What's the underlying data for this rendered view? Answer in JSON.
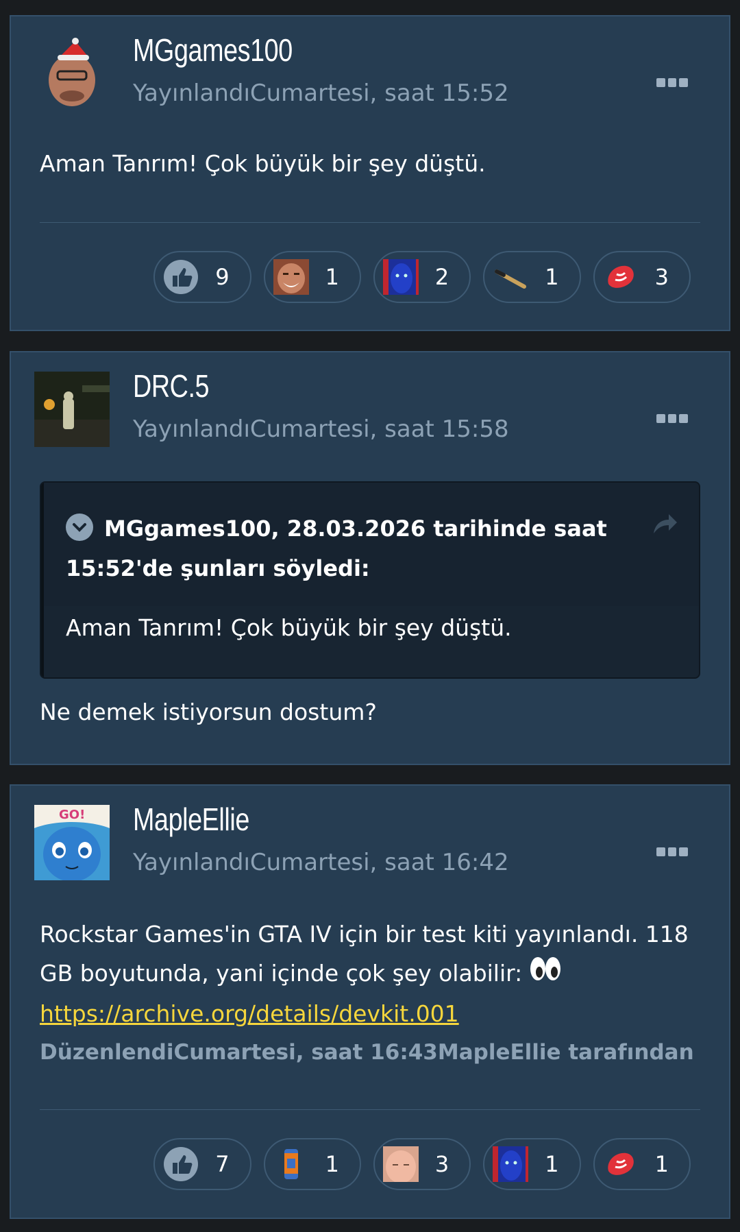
{
  "posts": [
    {
      "username": "MGgames100",
      "posted": "YayınlandıCumartesi, saat 15:52",
      "avatar_icon": "santa-hat-avatar-icon",
      "body": "Aman Tanrım! Çok büyük bir şey düştü.",
      "reactions": [
        {
          "icon": "thumbs-up-icon",
          "count": "9"
        },
        {
          "icon": "laughing-man-icon",
          "count": "1"
        },
        {
          "icon": "blue-face-icon",
          "count": "2"
        },
        {
          "icon": "bat-icon",
          "count": "1"
        },
        {
          "icon": "steak-icon",
          "count": "3"
        }
      ]
    },
    {
      "username": "DRC.5",
      "posted": "YayınlandıCumartesi, saat 15:58",
      "avatar_icon": "game-scene-avatar-icon",
      "quote": {
        "title": "MGgames100, 28.03.2026 tarihinde saat 15:52'de şunları söyledi:",
        "body": "Aman Tanrım! Çok büyük bir şey düştü."
      },
      "body": "Ne demek istiyorsun dostum?"
    },
    {
      "username": "MapleEllie",
      "posted": "YayınlandıCumartesi, saat 16:42",
      "avatar_icon": "anime-girl-avatar-icon",
      "body_line1": "Rockstar Games'in GTA IV için bir test kiti yayınlandı. 118",
      "body_line2": "GB boyutunda, yani içinde çok şey olabilir:",
      "link": "https://archive.org/details/devkit.001",
      "edited": "DüzenlendiCumartesi, saat 16:43MapleEllie tarafından",
      "reactions": [
        {
          "icon": "thumbs-up-icon",
          "count": "7"
        },
        {
          "icon": "soda-can-icon",
          "count": "1"
        },
        {
          "icon": "bald-man-icon",
          "count": "3"
        },
        {
          "icon": "blue-face-icon",
          "count": "1"
        },
        {
          "icon": "steak-icon",
          "count": "1"
        }
      ]
    }
  ]
}
